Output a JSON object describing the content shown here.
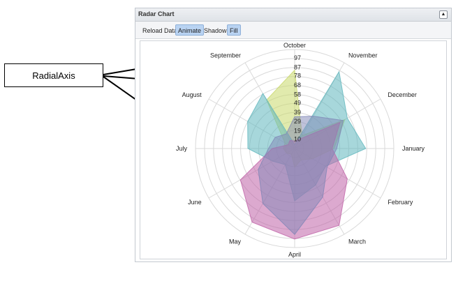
{
  "callout": {
    "label": "RadialAxis"
  },
  "panel": {
    "title": "Radar Chart",
    "collapse_symbol": "▲"
  },
  "toolbar": {
    "buttons": [
      {
        "label": "Reload Data",
        "active": false
      },
      {
        "label": "Animate",
        "active": true
      },
      {
        "label": "Shadow",
        "active": false
      },
      {
        "label": "Fill",
        "active": true
      }
    ]
  },
  "chart_data": {
    "type": "radar",
    "categories": [
      "October",
      "November",
      "December",
      "January",
      "February",
      "March",
      "April",
      "May",
      "June",
      "July",
      "August",
      "September"
    ],
    "radial_ticks": [
      "10",
      "19",
      "29",
      "39",
      "49",
      "58",
      "68",
      "78",
      "87",
      "97"
    ],
    "rmax": 106,
    "series": [
      {
        "color": "#c9d86a",
        "opacity": 0.55,
        "values": [
          84,
          16,
          62,
          42,
          22,
          14,
          20,
          7,
          10,
          12,
          12,
          60
        ]
      },
      {
        "color": "#5fb6bd",
        "opacity": 0.55,
        "values": [
          4,
          95,
          65,
          76,
          38,
          45,
          56,
          20,
          27,
          50,
          58,
          68
        ]
      },
      {
        "color": "#c063a8",
        "opacity": 0.55,
        "values": [
          8,
          12,
          56,
          40,
          65,
          95,
          97,
          91,
          67,
          24,
          8,
          10
        ]
      },
      {
        "color": "#7f86b6",
        "opacity": 0.5,
        "values": [
          34,
          40,
          60,
          45,
          40,
          60,
          92,
          68,
          45,
          28,
          24,
          18
        ]
      }
    ]
  }
}
